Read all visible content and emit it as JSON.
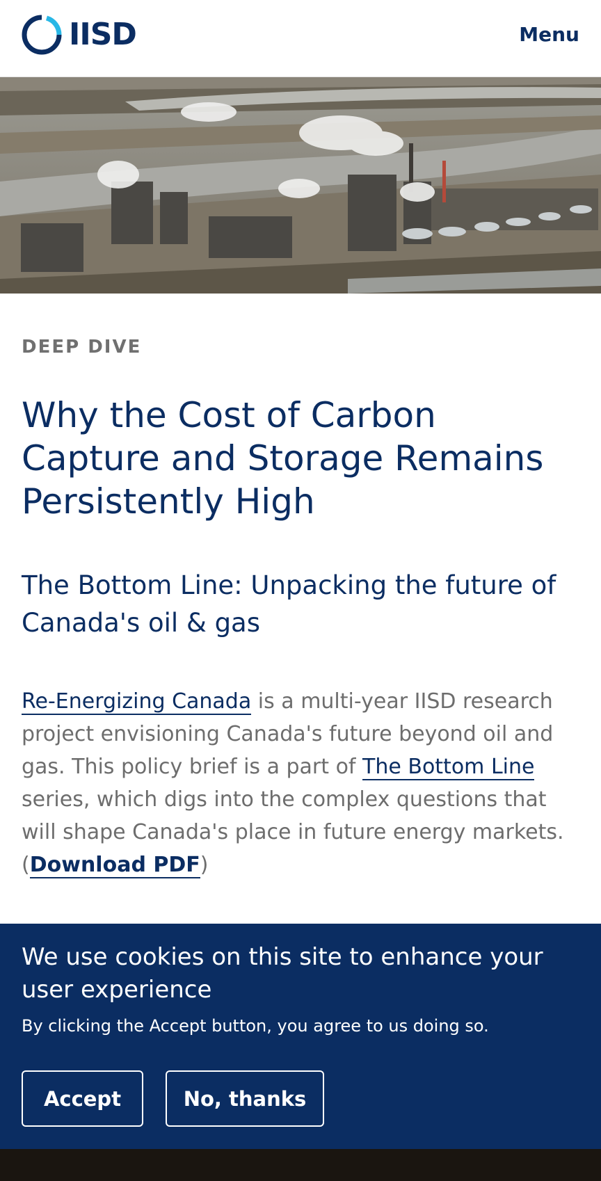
{
  "header": {
    "logo_text": "IISD",
    "menu_label": "Menu"
  },
  "hero": {
    "image_icon": "industrial-landscape-photo"
  },
  "article": {
    "eyebrow": "DEEP DIVE",
    "title": "Why the Cost of Carbon Capture and Storage Remains Persistently High",
    "subtitle": "The Bottom Line: Unpacking the future of Canada's oil & gas",
    "intro": {
      "link_reenergizing": "Re-Energizing Canada",
      "text_1": " is a multi-year IISD research project envisioning Canada's future beyond oil and gas. This policy brief is a part of ",
      "link_bottom_line": "The Bottom Line",
      "text_2": " series, which digs into the complex questions that will shape Canada's place in future energy markets. (",
      "link_pdf": "Download PDF",
      "text_3": ")"
    }
  },
  "cookie_banner": {
    "title": "We use cookies on this site to enhance your user experience",
    "description": "By clicking the Accept button, you agree to us doing so.",
    "accept_label": "Accept",
    "decline_label": "No, thanks"
  },
  "colors": {
    "brand_navy": "#0b2d62",
    "brand_cyan": "#28b7e6",
    "body_gray": "#6d6d6d",
    "footer_dark": "#1a1510"
  }
}
